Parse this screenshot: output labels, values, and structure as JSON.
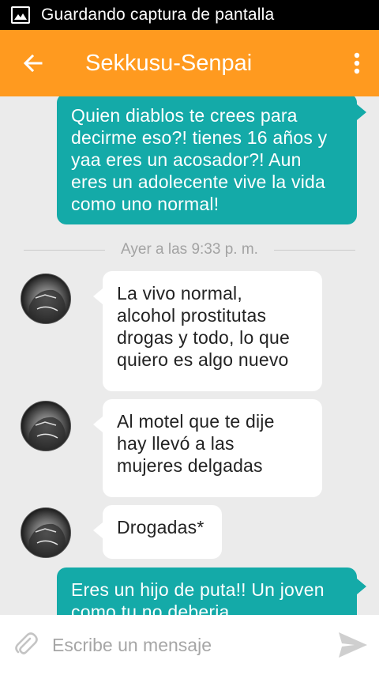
{
  "status_bar": {
    "text": "Guardando captura de pantalla",
    "icon": "image-icon"
  },
  "header": {
    "title": "Sekkusu-Senpai",
    "back_icon": "arrow-back-icon",
    "menu_icon": "more-vert-icon"
  },
  "messages": [
    {
      "direction": "outgoing",
      "lines": [
        "Quien diablos te crees para",
        "decirme eso?! tienes 16 años y",
        "yaa eres un acosador?! Aun",
        "eres un adolecente vive la vida",
        "como uno normal!"
      ]
    },
    {
      "direction": "incoming",
      "lines": [
        "La vivo normal,",
        "alcohol prostitutas",
        "drogas y todo, lo que",
        "quiero es algo nuevo"
      ]
    },
    {
      "direction": "incoming",
      "lines": [
        "Al motel que te dije",
        "hay llevó a las",
        "mujeres delgadas"
      ]
    },
    {
      "direction": "incoming",
      "lines": [
        "Drogadas*"
      ]
    },
    {
      "direction": "outgoing",
      "lines": [
        "Eres un hijo de puta!! Un joven",
        "como tu no deberia"
      ]
    }
  ],
  "date_separator": "Ayer a las 9:33 p. m.",
  "composer": {
    "placeholder": "Escribe un mensaje",
    "attach_icon": "paperclip-icon",
    "send_icon": "send-icon"
  },
  "colors": {
    "app_bar": "#ff9a1f",
    "outgoing_bubble": "#14aaa8",
    "incoming_bubble": "#ffffff",
    "background": "#ebebeb",
    "status_bar": "#000000"
  }
}
